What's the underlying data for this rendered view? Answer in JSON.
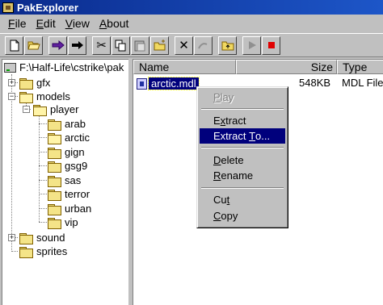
{
  "window": {
    "title": "PakExplorer"
  },
  "menu": [
    {
      "accel": "F",
      "rest": "ile"
    },
    {
      "accel": "E",
      "rest": "dit"
    },
    {
      "accel": "V",
      "rest": "iew"
    },
    {
      "accel": "A",
      "rest": "bout"
    }
  ],
  "tree": {
    "root": "F:\\Half-Life\\cstrike\\pak",
    "items": [
      "gfx",
      "models",
      "player",
      "arab",
      "arctic",
      "gign",
      "gsg9",
      "sas",
      "terror",
      "urban",
      "vip",
      "sound",
      "sprites"
    ]
  },
  "list": {
    "columns": {
      "name": "Name",
      "size": "Size",
      "type": "Type"
    },
    "rows": [
      {
        "name": "arctic.mdl",
        "size": "548KB",
        "type": "MDL File"
      }
    ]
  },
  "context_menu": {
    "play": {
      "accel": "P",
      "rest": "lay"
    },
    "extract": {
      "pre": "E",
      "accel": "x",
      "rest": "tract"
    },
    "extract_to": {
      "pre": "Extract ",
      "accel": "T",
      "rest": "o..."
    },
    "delete": {
      "accel": "D",
      "rest": "elete"
    },
    "rename": {
      "accel": "R",
      "rest": "ename"
    },
    "cut": {
      "pre": "Cu",
      "accel": "t",
      "rest": ""
    },
    "copy": {
      "accel": "C",
      "rest": "opy"
    }
  },
  "colors": {
    "titlebar": "#0a2a8c",
    "selection": "#00007c",
    "face": "#c0c0c0"
  }
}
